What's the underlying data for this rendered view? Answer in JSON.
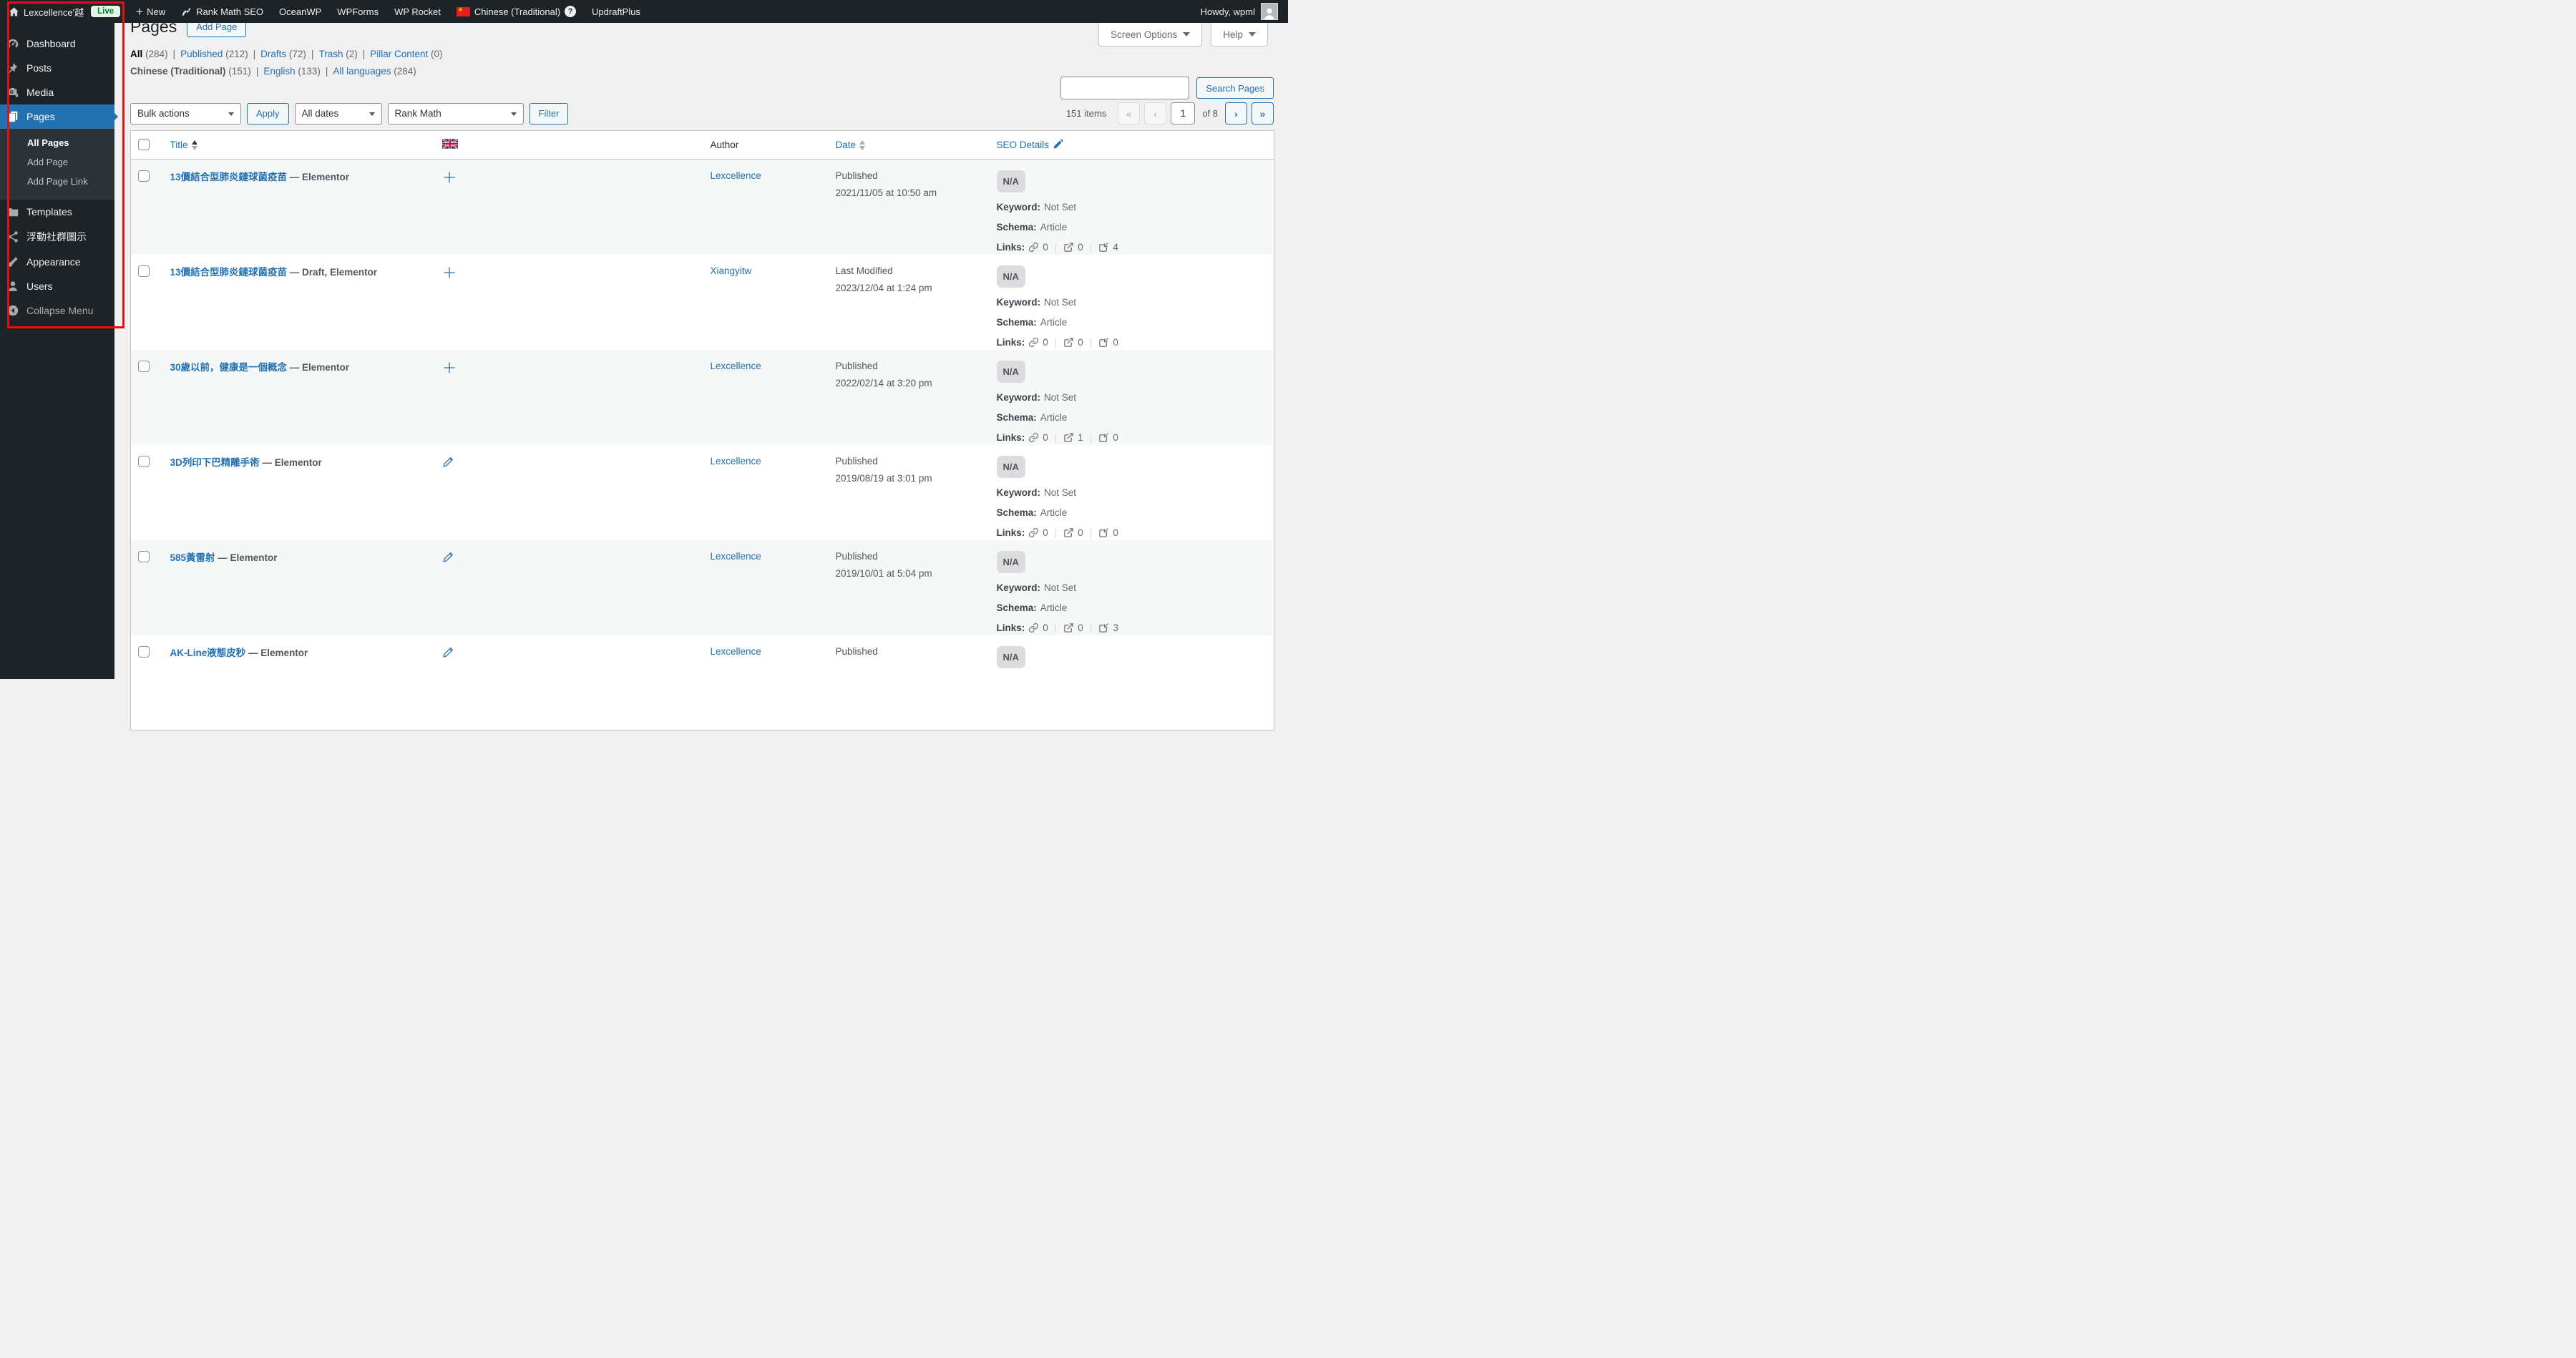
{
  "colors": {
    "accent": "#2271b1",
    "admin_dark": "#1d2327",
    "annotation_red": "#e90d0d",
    "stripe": "#f6f7f7",
    "badge_bg": "#dcdcde"
  },
  "admin_bar": {
    "site_name": "Lexcellence'越",
    "live_badge": "Live",
    "new_label": "New",
    "rank_math": "Rank Math SEO",
    "oceanwp": "OceanWP",
    "wpforms": "WPForms",
    "wp_rocket": "WP Rocket",
    "language": "Chinese (Traditional)",
    "updraft": "UpdraftPlus",
    "howdy": "Howdy, wpml"
  },
  "tabs": {
    "screen_options": "Screen Options",
    "help": "Help"
  },
  "sidebar": {
    "items": [
      {
        "label": "Dashboard"
      },
      {
        "label": "Posts"
      },
      {
        "label": "Media"
      },
      {
        "label": "Pages"
      },
      {
        "label": "Templates"
      },
      {
        "label": "浮動社群圖示"
      },
      {
        "label": "Appearance"
      },
      {
        "label": "Users"
      },
      {
        "label": "Collapse Menu"
      }
    ],
    "submenu": [
      {
        "label": "All Pages",
        "current": true
      },
      {
        "label": "Add Page",
        "current": false
      },
      {
        "label": "Add Page Link",
        "current": false
      }
    ]
  },
  "header": {
    "title": "Pages",
    "add_page": "Add Page"
  },
  "filters": {
    "status": [
      {
        "label": "All",
        "count": "(284)",
        "current": true
      },
      {
        "label": "Published",
        "count": "(212)",
        "current": false
      },
      {
        "label": "Drafts",
        "count": "(72)",
        "current": false
      },
      {
        "label": "Trash",
        "count": "(2)",
        "current": false
      },
      {
        "label": "Pillar Content",
        "count": "(0)",
        "current": false
      }
    ],
    "languages": [
      {
        "label": "Chinese (Traditional)",
        "count": "(151)",
        "current": true
      },
      {
        "label": "English",
        "count": "(133)",
        "current": false
      },
      {
        "label": "All languages",
        "count": "(284)",
        "current": false
      }
    ]
  },
  "search": {
    "value": "",
    "button": "Search Pages"
  },
  "toolbar": {
    "bulk_actions": "Bulk actions",
    "apply": "Apply",
    "all_dates": "All dates",
    "rank_math": "Rank Math",
    "filter": "Filter"
  },
  "pagination": {
    "items": "151 items",
    "first": "«",
    "prev": "‹",
    "page": "1",
    "of": "of 8",
    "next": "›",
    "last": "»"
  },
  "table": {
    "headers": {
      "title": "Title",
      "author": "Author",
      "date": "Date",
      "seo": "SEO Details"
    },
    "seo_labels": {
      "keyword": "Keyword:",
      "schema": "Schema:",
      "links": "Links:"
    },
    "rows": [
      {
        "title": "13價結合型肺炎鏈球菌疫苗",
        "suffix": " — Elementor",
        "translation": "add",
        "author": "Lexcellence",
        "status": "Published",
        "date": "2021/11/05 at 10:50 am",
        "seo": {
          "badge": "N/A",
          "keyword": "Not Set",
          "schema": "Article",
          "links": {
            "internal": "0",
            "external": "0",
            "incoming": "4"
          }
        }
      },
      {
        "title": "13價結合型肺炎鏈球菌疫苗",
        "suffix": " — Draft, Elementor",
        "translation": "add",
        "author": "Xiangyitw",
        "status": "Last Modified",
        "date": "2023/12/04 at 1:24 pm",
        "seo": {
          "badge": "N/A",
          "keyword": "Not Set",
          "schema": "Article",
          "links": {
            "internal": "0",
            "external": "0",
            "incoming": "0"
          }
        }
      },
      {
        "title": "30歲以前，健康是一個概念",
        "suffix": " — Elementor",
        "translation": "add",
        "author": "Lexcellence",
        "status": "Published",
        "date": "2022/02/14 at 3:20 pm",
        "seo": {
          "badge": "N/A",
          "keyword": "Not Set",
          "schema": "Article",
          "links": {
            "internal": "0",
            "external": "1",
            "incoming": "0"
          }
        }
      },
      {
        "title": "3D列印下巴精雕手術",
        "suffix": " — Elementor",
        "translation": "edit",
        "author": "Lexcellence",
        "status": "Published",
        "date": "2019/08/19 at 3:01 pm",
        "seo": {
          "badge": "N/A",
          "keyword": "Not Set",
          "schema": "Article",
          "links": {
            "internal": "0",
            "external": "0",
            "incoming": "0"
          }
        }
      },
      {
        "title": "585黃雷射",
        "suffix": " — Elementor",
        "translation": "edit",
        "author": "Lexcellence",
        "status": "Published",
        "date": "2019/10/01 at 5:04 pm",
        "seo": {
          "badge": "N/A",
          "keyword": "Not Set",
          "schema": "Article",
          "links": {
            "internal": "0",
            "external": "0",
            "incoming": "3"
          }
        }
      },
      {
        "title": "AK-Line液態皮秒",
        "suffix": " — Elementor",
        "translation": "edit",
        "author": "Lexcellence",
        "status": "Published",
        "date": null,
        "seo": {
          "badge": "N/A"
        }
      }
    ]
  }
}
